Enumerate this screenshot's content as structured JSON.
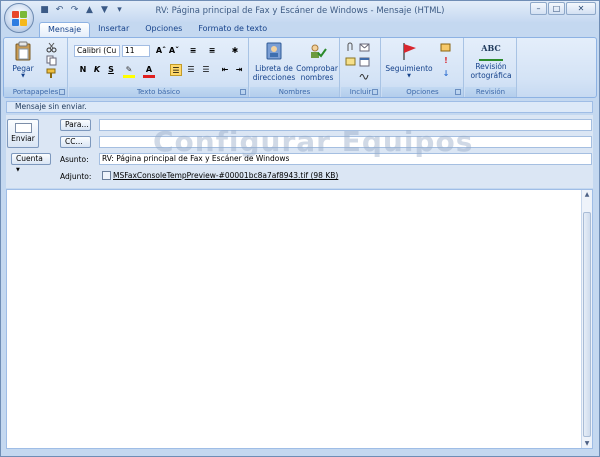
{
  "window": {
    "title": "RV: Página principal de Fax y Escáner de Windows - Mensaje (HTML)"
  },
  "tabs": [
    "Mensaje",
    "Insertar",
    "Opciones",
    "Formato de texto"
  ],
  "ribbon": {
    "clipboard": {
      "paste_label": "Pegar",
      "group_label": "Portapapeles"
    },
    "text": {
      "font_value": "Calibri (Cu",
      "size_value": "11",
      "group_label": "Texto básico"
    },
    "names": {
      "address_book_label": "Libreta de direcciones",
      "check_names_label": "Comprobar nombres",
      "group_label": "Nombres"
    },
    "include": {
      "group_label": "Incluir"
    },
    "options": {
      "follow_up_label": "Seguimiento",
      "group_label": "Opciones"
    },
    "proofing": {
      "abc_text": "ABC",
      "spelling_label": "Revisión ortográfica",
      "group_label": "Revisión"
    }
  },
  "message": {
    "info_bar": "Mensaje sin enviar.",
    "send_label": "Enviar",
    "to_label": "Para...",
    "cc_label": "CC...",
    "account_label": "Cuenta",
    "subject_label": "Asunto:",
    "subject_value": "RV: Página principal de Fax y Escáner de Windows",
    "attachment_label": "Adjunto:",
    "attachment_value": "MSFaxConsoleTempPreview-#00001bc8a7af8943.tif (98 KB)"
  },
  "watermark": "Configurar Equipos",
  "colors": {
    "accent": "#15428b",
    "ribbon": "#d4e3f6"
  }
}
